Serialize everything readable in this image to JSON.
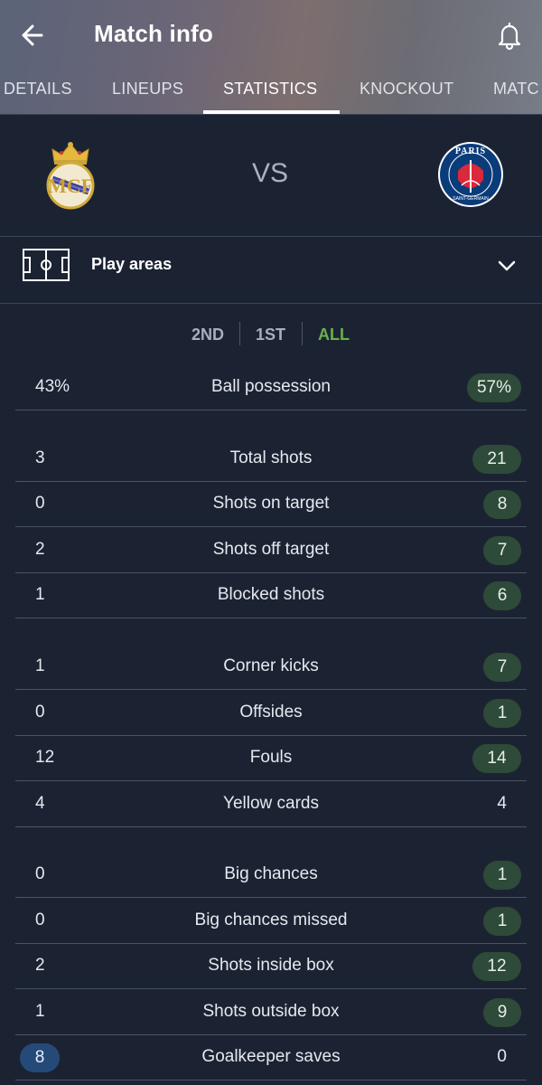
{
  "header": {
    "title": "Match info",
    "back_icon": "arrow-left-icon",
    "bell_icon": "bell-icon"
  },
  "tabs": [
    {
      "label": "DETAILS"
    },
    {
      "label": "LINEUPS"
    },
    {
      "label": "STATISTICS"
    },
    {
      "label": "KNOCKOUT"
    },
    {
      "label": "MATC"
    }
  ],
  "active_tab": "STATISTICS",
  "teams": {
    "home_crest": "real-madrid-crest",
    "away_crest": "psg-crest",
    "away_crest_text": "PARIS",
    "away_crest_subtext": "SAINT-GERMAIN",
    "vs": "VS"
  },
  "play_areas": {
    "label": "Play areas",
    "icon": "pitch-icon",
    "chevron": "chevron-down-icon"
  },
  "periods": [
    {
      "label": "2ND"
    },
    {
      "label": "1ST"
    },
    {
      "label": "ALL"
    }
  ],
  "active_period": "ALL",
  "colors": {
    "background": "#1b2333",
    "accent_green": "#6bb24a",
    "pill_green": "#2e4a38",
    "pill_blue": "#254a78"
  },
  "stats": [
    {
      "home": "43%",
      "label": "Ball possession",
      "away": "57%",
      "highlight": "away"
    },
    {
      "home": "3",
      "label": "Total shots",
      "away": "21",
      "highlight": "away"
    },
    {
      "home": "0",
      "label": "Shots on target",
      "away": "8",
      "highlight": "away"
    },
    {
      "home": "2",
      "label": "Shots off target",
      "away": "7",
      "highlight": "away"
    },
    {
      "home": "1",
      "label": "Blocked shots",
      "away": "6",
      "highlight": "away"
    },
    {
      "home": "1",
      "label": "Corner kicks",
      "away": "7",
      "highlight": "away"
    },
    {
      "home": "0",
      "label": "Offsides",
      "away": "1",
      "highlight": "away"
    },
    {
      "home": "12",
      "label": "Fouls",
      "away": "14",
      "highlight": "away"
    },
    {
      "home": "4",
      "label": "Yellow cards",
      "away": "4",
      "highlight": "none"
    },
    {
      "home": "0",
      "label": "Big chances",
      "away": "1",
      "highlight": "away"
    },
    {
      "home": "0",
      "label": "Big chances missed",
      "away": "1",
      "highlight": "away"
    },
    {
      "home": "2",
      "label": "Shots inside box",
      "away": "12",
      "highlight": "away"
    },
    {
      "home": "1",
      "label": "Shots outside box",
      "away": "9",
      "highlight": "away"
    },
    {
      "home": "8",
      "label": "Goalkeeper saves",
      "away": "0",
      "highlight": "home"
    }
  ]
}
